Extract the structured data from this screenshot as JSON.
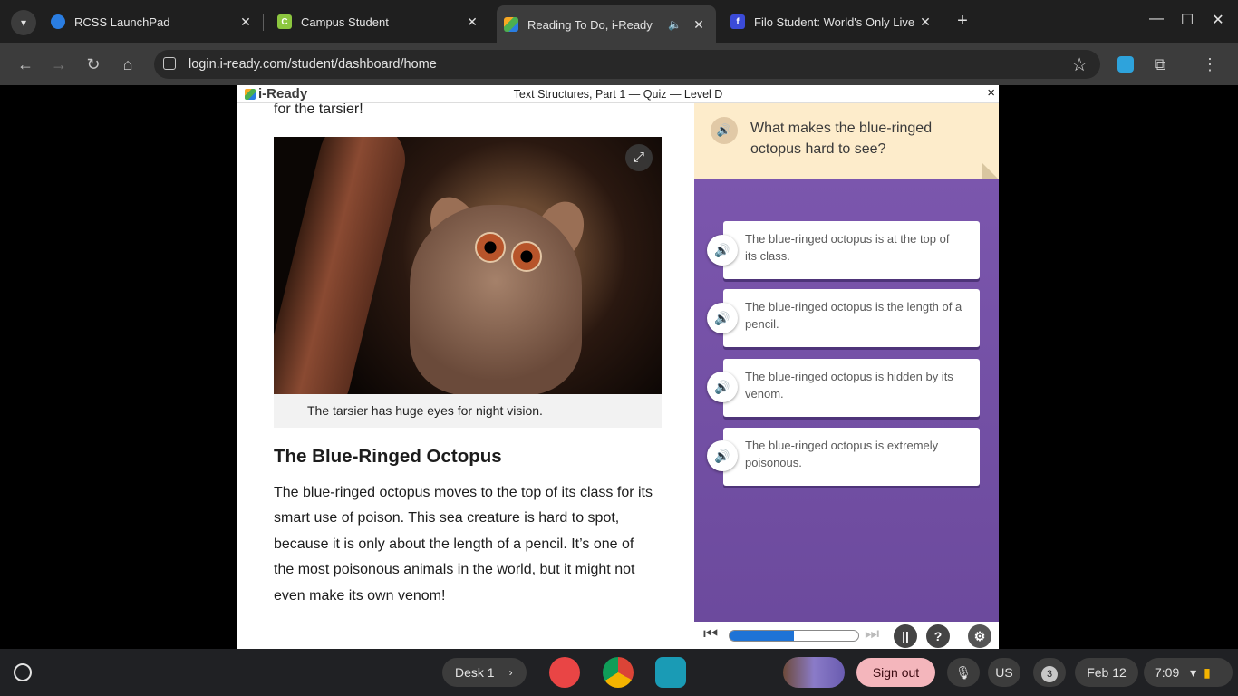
{
  "browser": {
    "tabs": [
      {
        "title": "RCSS LaunchPad",
        "favicon_color": "#2a7de1"
      },
      {
        "title": "Campus Student",
        "favicon_color": "#8cc63f"
      },
      {
        "title": "Reading To Do, i-Ready",
        "favicon_color": "#f7a823",
        "active": true
      },
      {
        "title": "Filo Student: World's Only Live I",
        "favicon_color": "#3b4bd8"
      }
    ],
    "url": "login.i-ready.com/student/dashboard/home"
  },
  "iready": {
    "logo": "i-Ready",
    "quiz_title": "Text Structures, Part 1 — Quiz — Level D",
    "close": "×"
  },
  "reading": {
    "fragment": "for the tarsier!",
    "image_caption": "The tarsier has huge eyes for night vision.",
    "section_title": "The Blue-Ringed Octopus",
    "body": "The blue-ringed octopus moves to the top of its class for its smart use of poison. This sea creature is hard to spot, because it is only about the length of a pencil. It’s one of the most poisonous animals in the world, but it might not even make its own venom!"
  },
  "question": {
    "prompt": "What makes the blue-ringed octopus hard to see?",
    "answers": [
      "The blue-ringed octopus is at the top of its class.",
      "The blue-ringed octopus is the length of a pencil.",
      "The blue-ringed octopus is hidden by its venom.",
      "The blue-ringed octopus is extremely poisonous."
    ]
  },
  "controls": {
    "progress_fraction": 0.5,
    "pause": "||",
    "help": "?",
    "progress_color": "#1e73d6"
  },
  "shelf": {
    "desk": "Desk 1",
    "sign_out": "Sign out",
    "input_method": "US",
    "notification_count": "3",
    "date": "Feb 12",
    "time": "7:09"
  }
}
